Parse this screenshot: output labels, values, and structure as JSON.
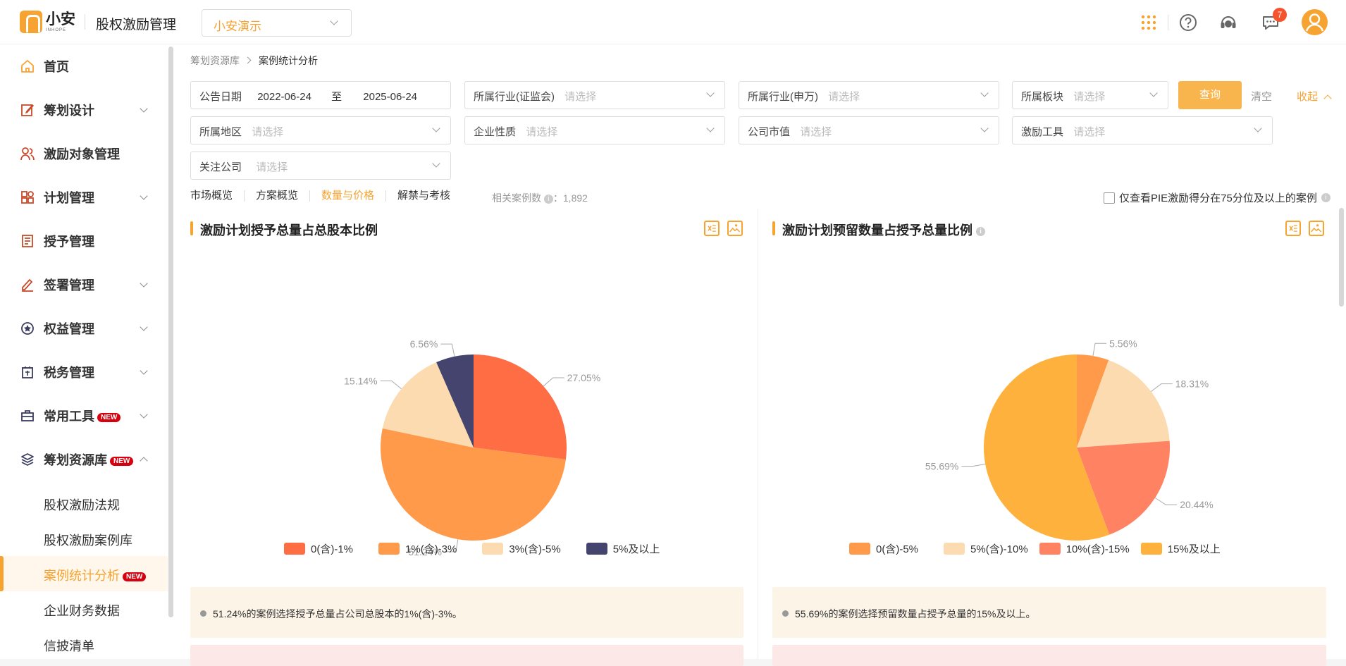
{
  "header": {
    "logo_text": "小安",
    "logo_sub": "INHOPE",
    "app_title": "股权激励管理",
    "org_select": "小安演示",
    "message_badge": "7",
    "icons": [
      "apps-grid-icon",
      "help-icon",
      "customer-service-icon",
      "message-icon",
      "avatar-icon"
    ]
  },
  "sidebar": {
    "items": [
      {
        "label": "首页",
        "icon": "home-icon",
        "expandable": false
      },
      {
        "label": "筹划设计",
        "icon": "edit-icon",
        "expandable": true
      },
      {
        "label": "激励对象管理",
        "icon": "users-icon",
        "expandable": false
      },
      {
        "label": "计划管理",
        "icon": "apps-icon",
        "expandable": true
      },
      {
        "label": "授予管理",
        "icon": "document-icon",
        "expandable": false
      },
      {
        "label": "签署管理",
        "icon": "sign-icon",
        "expandable": true
      },
      {
        "label": "权益管理",
        "icon": "equity-icon",
        "expandable": true
      },
      {
        "label": "税务管理",
        "icon": "tax-icon",
        "expandable": true
      },
      {
        "label": "常用工具",
        "icon": "toolbox-icon",
        "expandable": true,
        "tag": "NEW"
      },
      {
        "label": "筹划资源库",
        "icon": "layers-icon",
        "expandable": true,
        "expanded": true,
        "tag": "NEW"
      }
    ],
    "subitems": [
      {
        "label": "股权激励法规"
      },
      {
        "label": "股权激励案例库"
      },
      {
        "label": "案例统计分析",
        "active": true,
        "tag": "NEW"
      },
      {
        "label": "企业财务数据"
      },
      {
        "label": "信披清单"
      }
    ]
  },
  "breadcrumb": {
    "parent": "筹划资源库",
    "current": "案例统计分析"
  },
  "filters": {
    "date_label": "公告日期",
    "date_from": "2022-06-24",
    "date_to_label": "至",
    "date_to": "2025-06-24",
    "placeholder": "请选择",
    "industry_csrc": "所属行业(证监会)",
    "industry_sw": "所属行业(申万)",
    "board": "所属板块",
    "region": "所属地区",
    "nature": "企业性质",
    "market_cap": "公司市值",
    "tool": "激励工具",
    "focus": "关注公司",
    "query_btn": "查询",
    "clear_btn": "清空",
    "collapse_btn": "收起"
  },
  "tabs": [
    {
      "label": "市场概览"
    },
    {
      "label": "方案概览"
    },
    {
      "label": "数量与价格",
      "active": true
    },
    {
      "label": "解禁与考核"
    }
  ],
  "case_count": {
    "label": "相关案例数",
    "sep": "：",
    "value": "1,892"
  },
  "pie_filter_label": "仅查看PIE激励得分在75分位及以上的案例",
  "colors": {
    "accent": "#f7a331",
    "c1": "#ff6d45",
    "c2": "#ff9a4a",
    "c3": "#fddbb0",
    "c4": "#44446e",
    "c5": "#ffb13d"
  },
  "chart_data": [
    {
      "type": "pie",
      "title": "激励计划授予总量占总股本比例",
      "categories": [
        "0(含)-1%",
        "1%(含)-3%",
        "3%(含)-5%",
        "5%及以上"
      ],
      "values": [
        27.05,
        51.24,
        15.14,
        6.56
      ],
      "labels": [
        "27.05%",
        "51.24%",
        "15.14%",
        "6.56%"
      ],
      "colors": [
        "#ff6d45",
        "#ff9a4a",
        "#fddbb0",
        "#44446e"
      ],
      "legend": "bottom",
      "note": "51.24%的案例选择授予总量占公司总股本的1%(含)-3%。"
    },
    {
      "type": "pie",
      "title": "激励计划预留数量占授予总量比例",
      "categories": [
        "0(含)-5%",
        "5%(含)-10%",
        "10%(含)-15%",
        "15%及以上"
      ],
      "values": [
        5.56,
        18.31,
        20.44,
        55.69
      ],
      "labels": [
        "5.56%",
        "18.31%",
        "20.44%",
        "55.69%"
      ],
      "colors": [
        "#ff9a4a",
        "#fddbb0",
        "#ff8262",
        "#ffb13d"
      ],
      "legend": "bottom",
      "note": "55.69%的案例选择预留数量占授予总量的15%及以上。"
    }
  ]
}
